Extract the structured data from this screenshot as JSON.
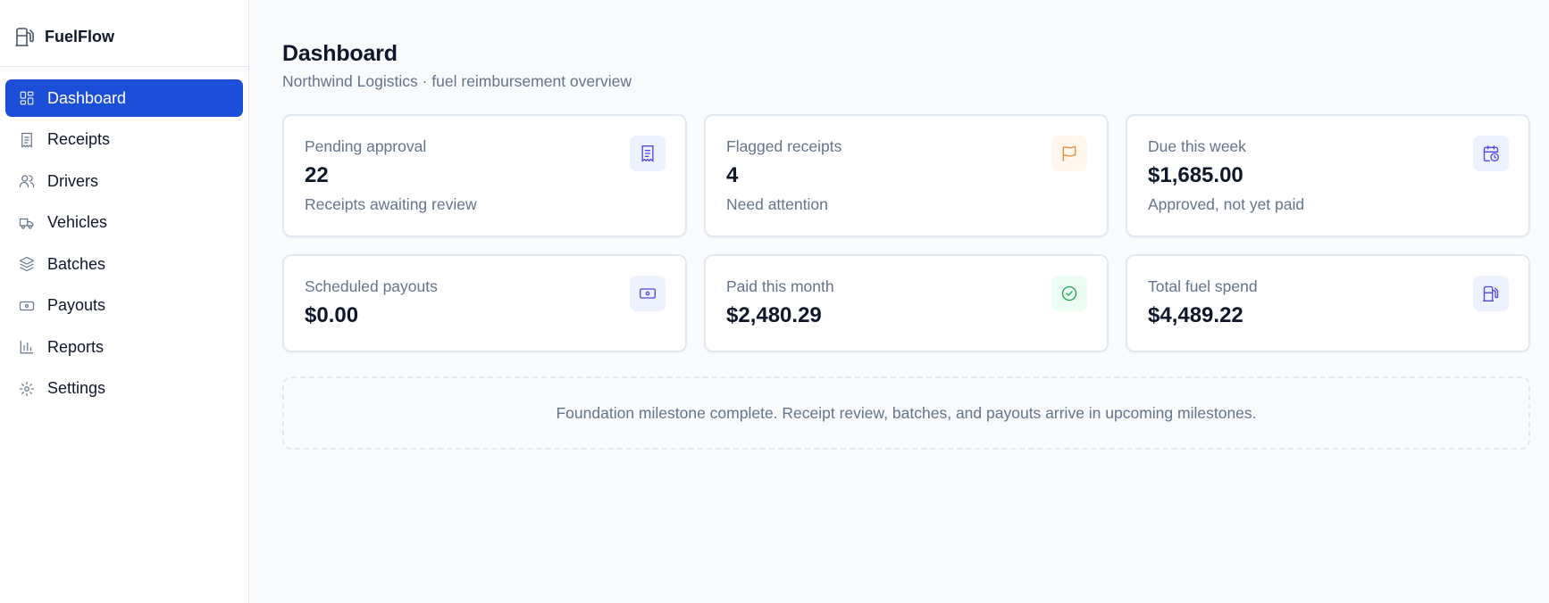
{
  "app": {
    "name": "FuelFlow",
    "icon": "fuel-pump-icon"
  },
  "sidebar": {
    "items": [
      {
        "label": "Dashboard",
        "icon": "dashboard-icon",
        "active": true
      },
      {
        "label": "Receipts",
        "icon": "receipt-icon"
      },
      {
        "label": "Drivers",
        "icon": "users-icon"
      },
      {
        "label": "Vehicles",
        "icon": "truck-icon"
      },
      {
        "label": "Batches",
        "icon": "layers-icon"
      },
      {
        "label": "Payouts",
        "icon": "banknote-icon"
      },
      {
        "label": "Reports",
        "icon": "bar-chart-icon"
      },
      {
        "label": "Settings",
        "icon": "gear-icon"
      }
    ]
  },
  "header": {
    "title": "Dashboard",
    "subtitle": "Northwind Logistics · fuel reimbursement overview"
  },
  "cards": [
    {
      "label": "Pending approval",
      "value": "22",
      "note": "Receipts awaiting review",
      "icon": "receipt-icon",
      "tone": "#4f46e5"
    },
    {
      "label": "Flagged receipts",
      "value": "4",
      "note": "Need attention",
      "icon": "flag-icon",
      "tone": "#ea8a3a"
    },
    {
      "label": "Due this week",
      "value": "$1,685.00",
      "note": "Approved, not yet paid",
      "icon": "calendar-clock-icon",
      "tone": "#4f46e5"
    },
    {
      "label": "Scheduled payouts",
      "value": "$0.00",
      "icon": "banknote-icon",
      "tone": "#4f46e5"
    },
    {
      "label": "Paid this month",
      "value": "$2,480.29",
      "icon": "check-circle-icon",
      "tone": "#16a34a"
    },
    {
      "label": "Total fuel spend",
      "value": "$4,489.22",
      "icon": "fuel-pump-icon",
      "tone": "#4f46e5"
    }
  ],
  "notice": {
    "text": "Foundation milestone complete. Receipt review, batches, and payouts arrive in upcoming milestones."
  },
  "colors": {
    "accent": "#1d4ed8",
    "muted_text": "#64748b",
    "border": "#e2e8f0"
  }
}
